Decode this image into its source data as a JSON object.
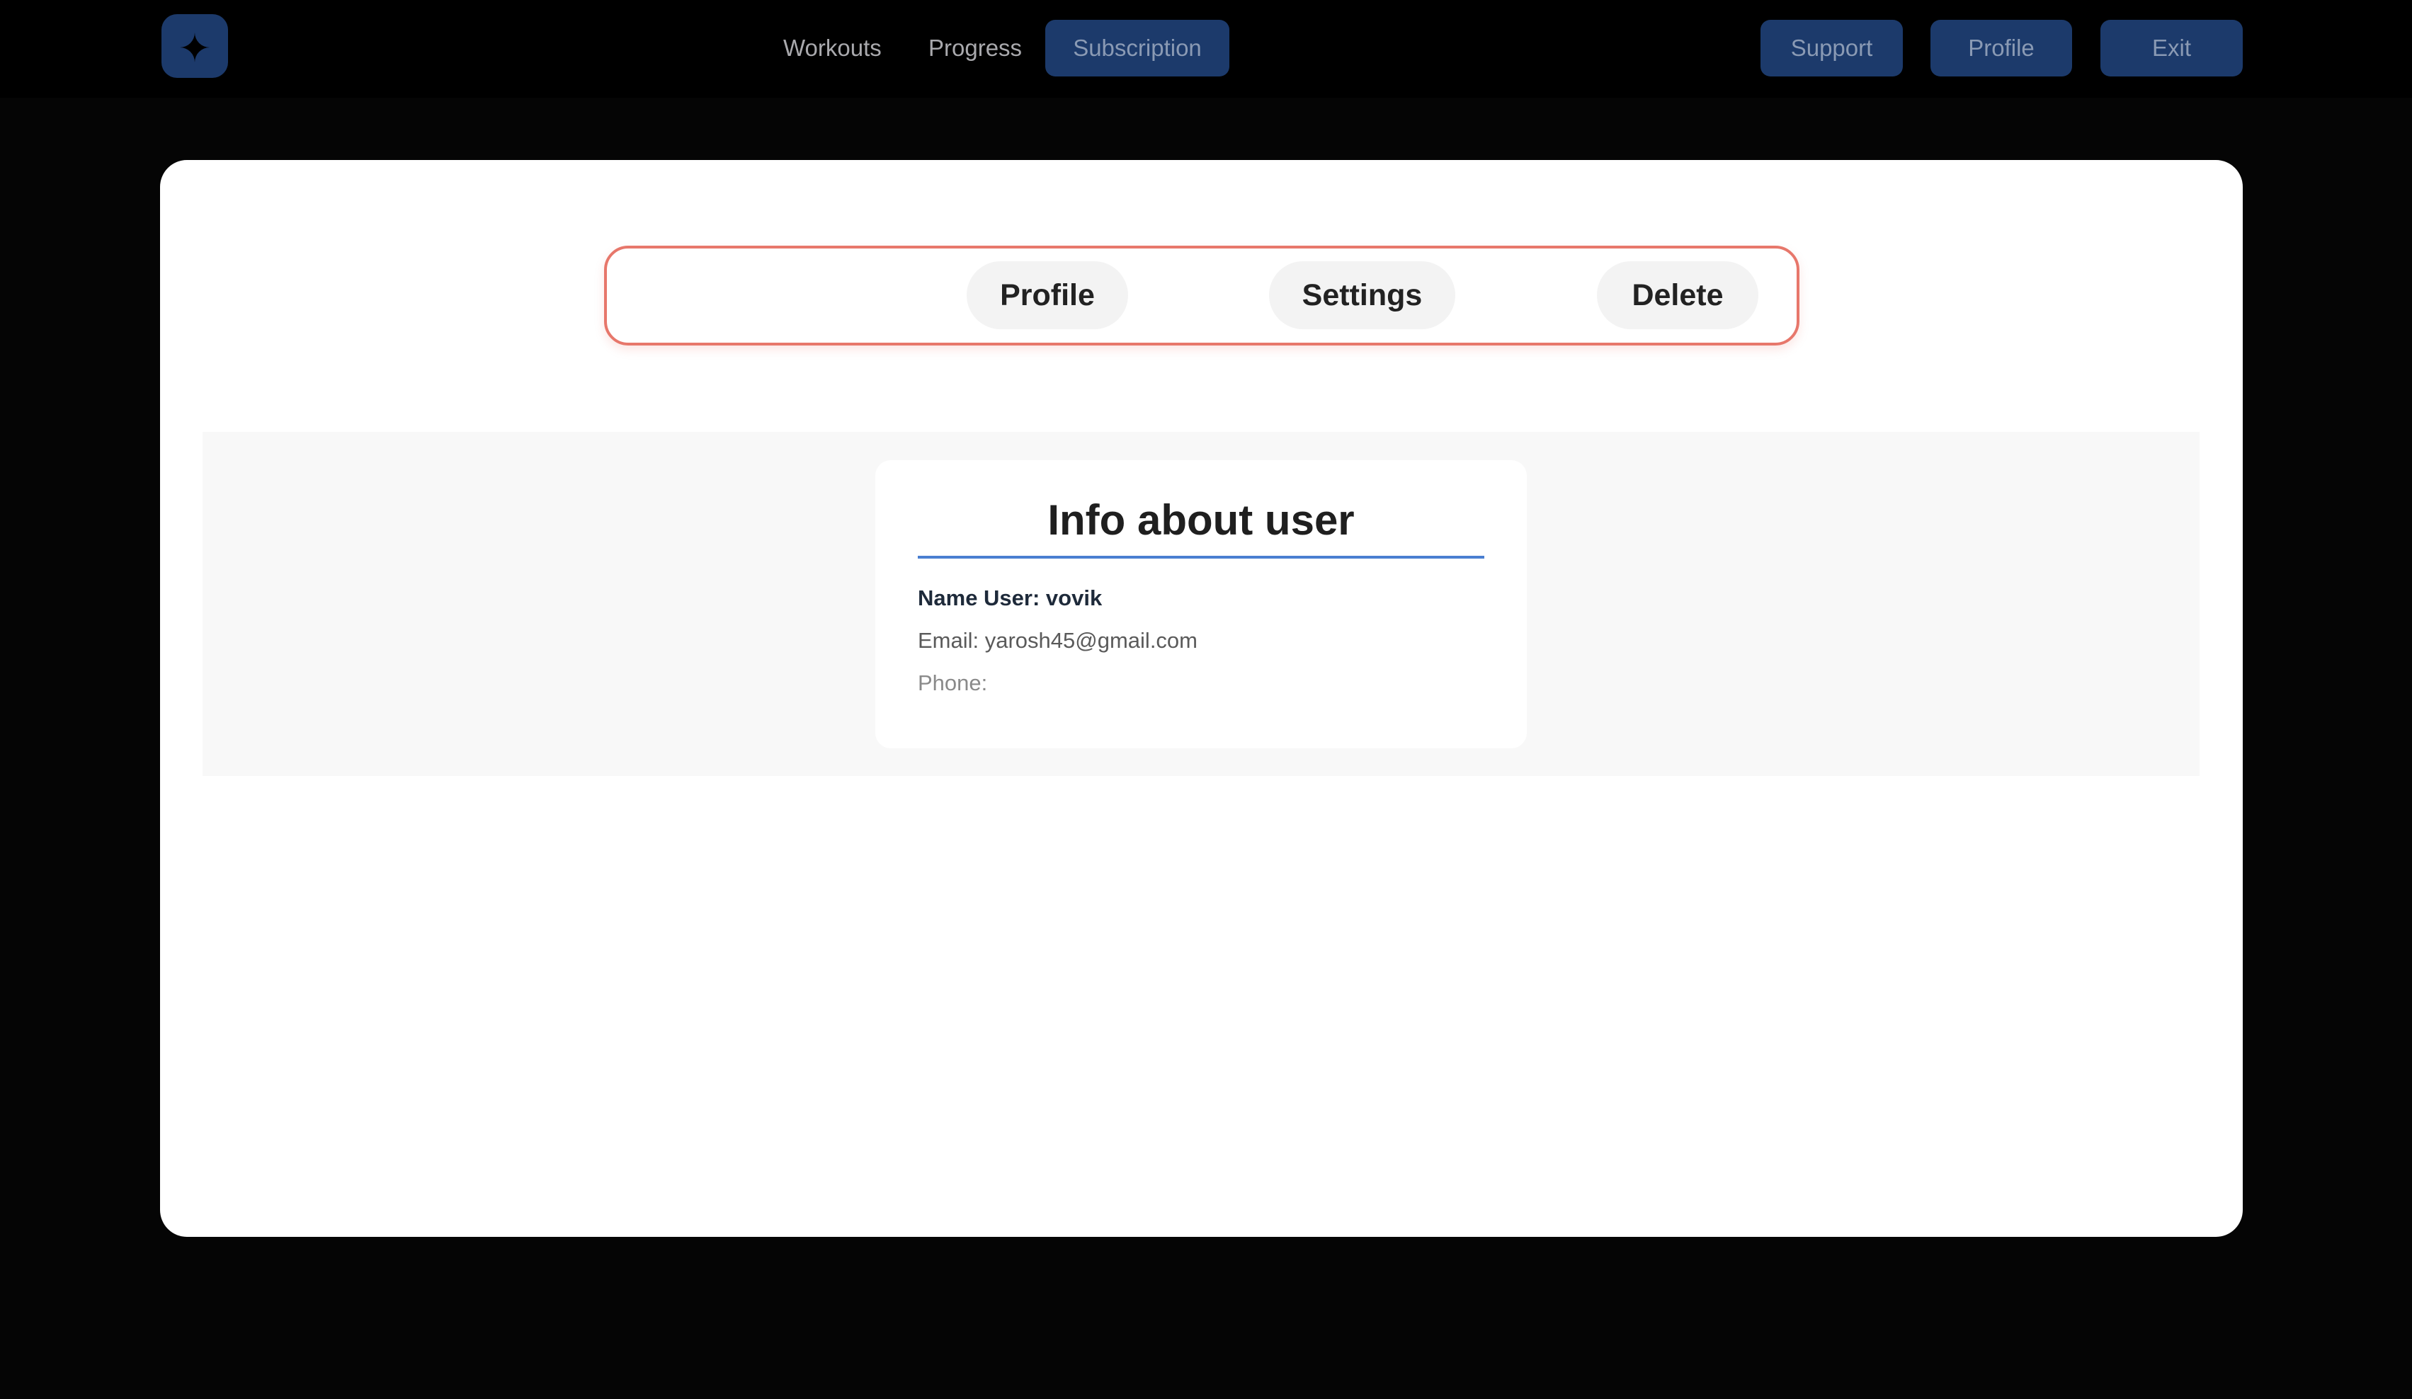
{
  "header": {
    "logo_icon": "four-petal-logo-icon",
    "nav": {
      "workouts": "Workouts",
      "progress": "Progress",
      "subscription": "Subscription"
    },
    "actions": {
      "support": "Support",
      "profile": "Profile",
      "exit": "Exit"
    }
  },
  "tabs": {
    "profile": "Profile",
    "settings": "Settings",
    "delete": "Delete"
  },
  "user_info": {
    "title": "Info about user",
    "name_line": "Name User: vovik",
    "email_line": "Email: yarosh45@gmail.com",
    "phone_line": "Phone:"
  },
  "colors": {
    "background": "#050505",
    "accent_button": "#1c3a6b",
    "tabbar_border": "#e7776b",
    "title_underline": "#4a7fd1"
  }
}
